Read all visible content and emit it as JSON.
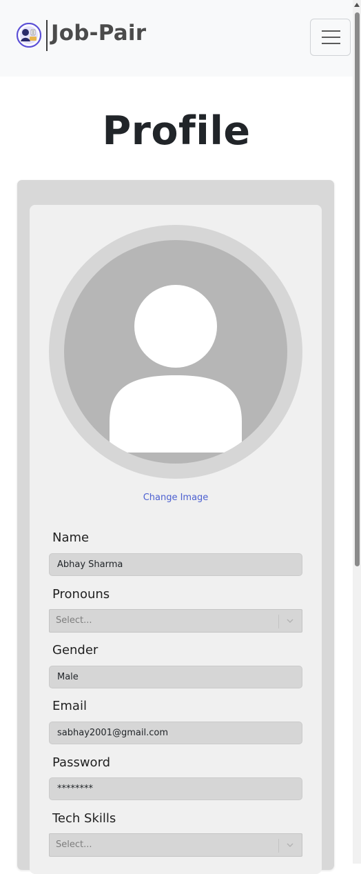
{
  "navbar": {
    "brand_name": "Job-Pair",
    "logo_icon": "job-pair-logo",
    "menu_icon": "hamburger-menu-icon"
  },
  "page": {
    "title": "Profile"
  },
  "profile": {
    "avatar_icon": "default-user-avatar-icon",
    "change_image_label": "Change Image"
  },
  "form": {
    "name": {
      "label": "Name",
      "value": "Abhay Sharma"
    },
    "pronouns": {
      "label": "Pronouns",
      "placeholder": "Select..."
    },
    "gender": {
      "label": "Gender",
      "value": "Male"
    },
    "email": {
      "label": "Email",
      "value": "sabhay2001@gmail.com"
    },
    "password": {
      "label": "Password",
      "value": "********"
    },
    "tech_skills": {
      "label": "Tech Skills",
      "placeholder": "Select..."
    }
  },
  "colors": {
    "navbar_bg": "#f8f9fa",
    "link": "#4b5fd0",
    "card_outer": "#d8d8d8",
    "card_inner": "#f0f0f0",
    "input_bg": "#d6d6d6"
  }
}
